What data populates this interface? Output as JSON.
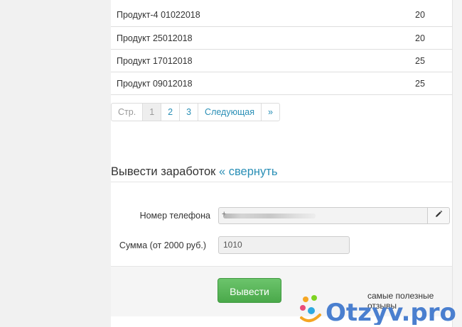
{
  "products": [
    {
      "name": "Продукт-4 01022018",
      "qty": "20"
    },
    {
      "name": "Продукт 25012018",
      "qty": "20"
    },
    {
      "name": "Продукт 17012018",
      "qty": "25"
    },
    {
      "name": "Продукт 09012018",
      "qty": "25"
    }
  ],
  "pagination": {
    "label": "Стр.",
    "pages": [
      "1",
      "2",
      "3"
    ],
    "current_page": "1",
    "next": "Следующая",
    "last": "»"
  },
  "withdraw": {
    "title": "Вывести заработок",
    "collapse_link": "« свернуть",
    "phone_label": "Номер телефона",
    "phone_value_prefix": "+",
    "sum_label": "Сумма (от 2000 руб.)",
    "sum_value": "1010",
    "submit_label": "Вывести"
  },
  "watermark": {
    "caption": "самые полезные отзывы",
    "logo_text": "Otzyv.pro"
  },
  "colors": {
    "link": "#2a8fb6",
    "submit": "#5cb85c",
    "logo_text": "#4a7fcf"
  },
  "icons": [
    "pencil-icon"
  ]
}
